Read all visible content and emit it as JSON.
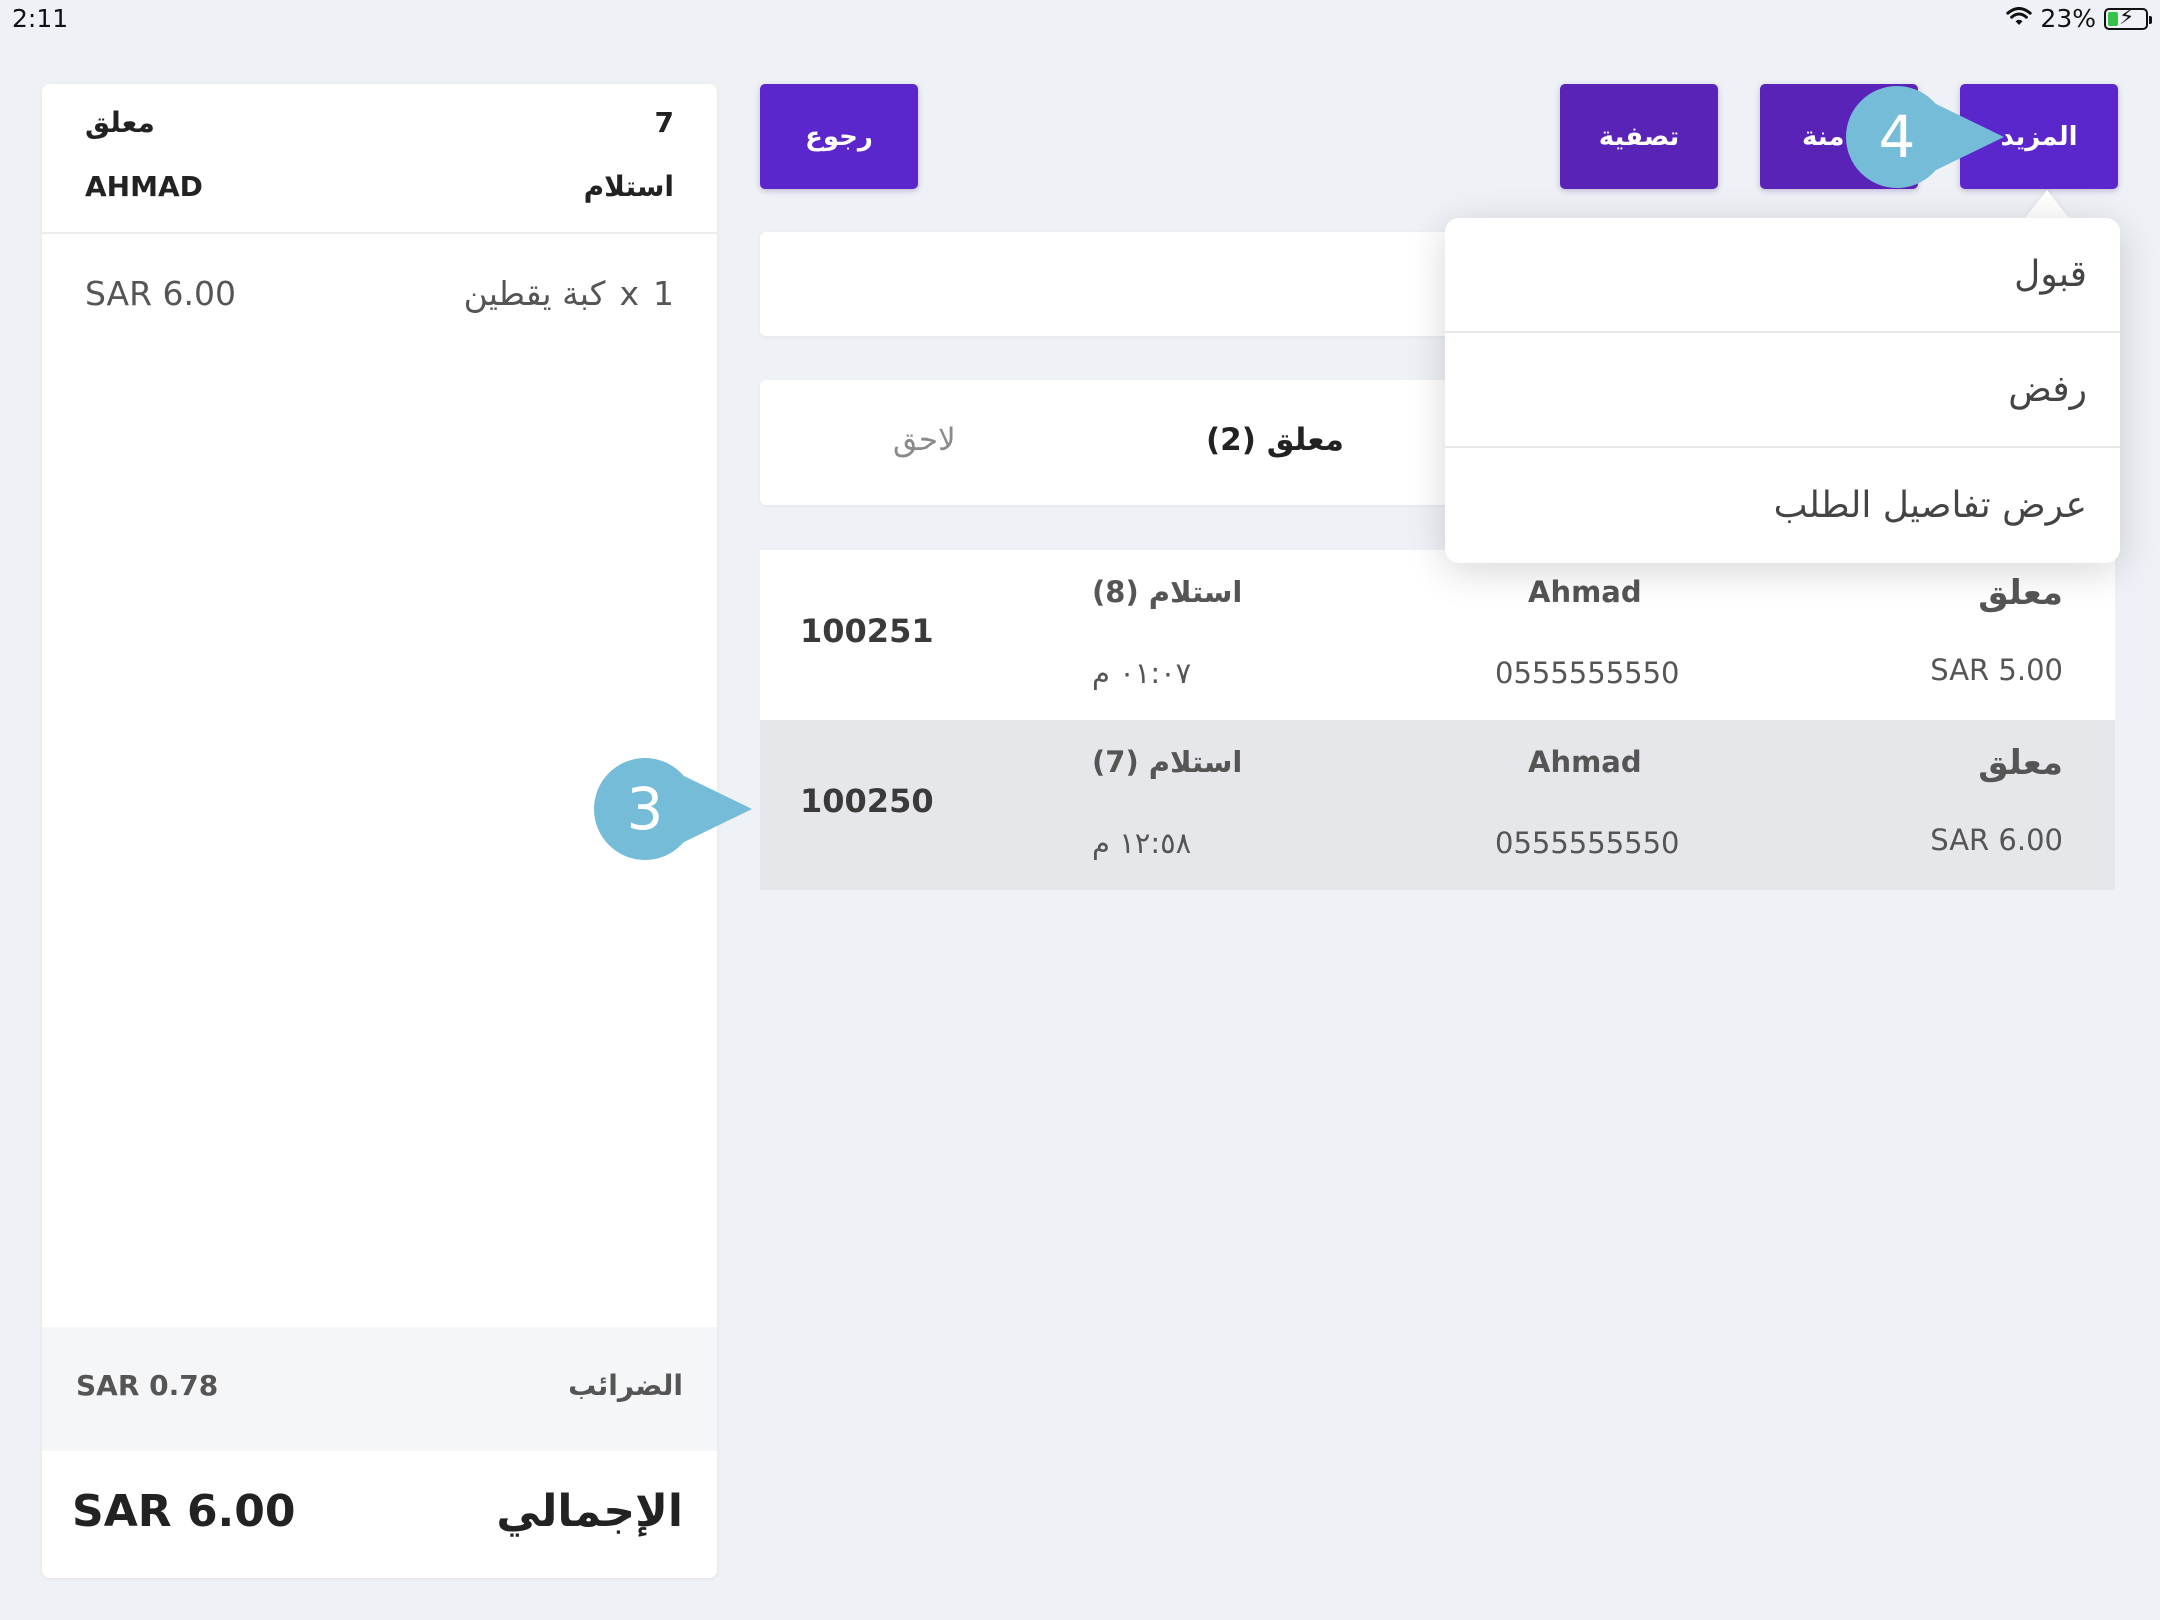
{
  "status_bar": {
    "time": "2:11",
    "battery_percent": "23%",
    "wifi_icon": "wifi-icon",
    "battery_icon": "battery-charging-icon"
  },
  "order_panel": {
    "status": "معلق",
    "order_number": "7",
    "customer_name": "AHMAD",
    "order_type": "استلام",
    "items": [
      {
        "quantity": "1",
        "x": "x",
        "name": "كبة يقطين",
        "price": "SAR 6.00"
      }
    ],
    "tax_label": "الضرائب",
    "tax_value": "SAR 0.78",
    "total_label": "الإجمالي",
    "total_value": "SAR 6.00"
  },
  "toolbar": {
    "back_label": "رجوع",
    "filter_label": "تصفية",
    "hidden_button_partial_label": "منة",
    "more_label": "المزيد"
  },
  "tabs": {
    "later_label": "لاحق",
    "pending_label": "معلق (2)"
  },
  "orders": [
    {
      "id": "100251",
      "type": "استلام (8)",
      "time": "٠١:٠٧ م",
      "customer": "Ahmad",
      "phone": "0555555550",
      "status": "معلق",
      "amount": "SAR 5.00"
    },
    {
      "id": "100250",
      "type": "استلام (7)",
      "time": "١٢:٥٨ م",
      "customer": "Ahmad",
      "phone": "0555555550",
      "status": "معلق",
      "amount": "SAR 6.00"
    }
  ],
  "dropdown_menu": {
    "items": [
      "قبول",
      "رفض",
      "عرض تفاصيل الطلب"
    ]
  },
  "callouts": {
    "first": "3",
    "second": "4"
  },
  "colors": {
    "primary_button": "#5b26cc",
    "callout": "#74bcd8",
    "background": "#eef1f5"
  }
}
